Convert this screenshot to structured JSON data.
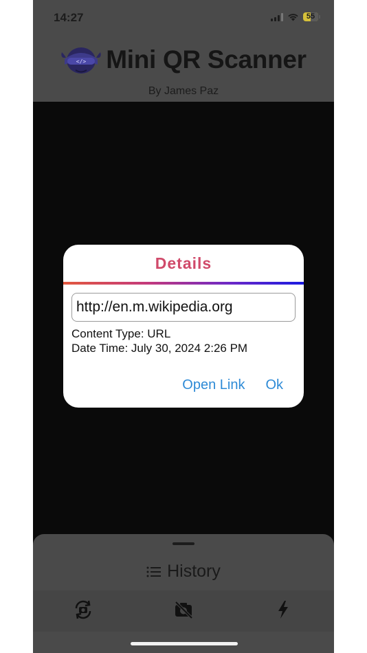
{
  "status_bar": {
    "time": "14:27",
    "battery": "55"
  },
  "header": {
    "app_title": "Mini QR Scanner",
    "subtitle": "By James Paz",
    "logo_icon": "masked-ninja-code-logo"
  },
  "dialog": {
    "title": "Details",
    "url_value": "http://en.m.wikipedia.org",
    "content_type": "Content Type: URL",
    "date_time": "Date Time: July 30, 2024 2:26 PM",
    "open_link_label": "Open Link",
    "ok_label": "Ok"
  },
  "bottom_sheet": {
    "history_label": "History",
    "history_icon": "list-icon",
    "tools": [
      "flip-camera-icon",
      "camera-off-icon",
      "flash-icon"
    ]
  },
  "colors": {
    "dialog_title": "#d04a6a",
    "button_blue": "#2d8ad6",
    "battery": "#d6c13a"
  }
}
